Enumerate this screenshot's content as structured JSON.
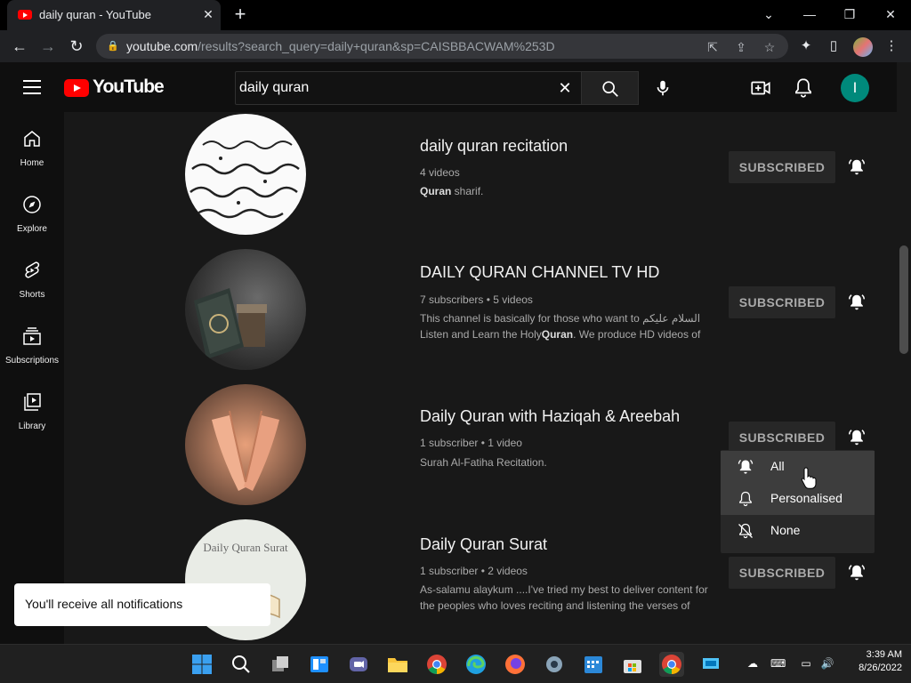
{
  "browser": {
    "tab_title": "daily quran - YouTube",
    "url_domain": "youtube.com",
    "url_path": "/results?search_query=daily+quran&sp=CAISBBACWAM%253D"
  },
  "header": {
    "logo_text": "YouTube",
    "search_value": "daily quran",
    "avatar_letter": "I"
  },
  "sidebar": {
    "items": [
      {
        "label": "Home",
        "icon": "home-icon"
      },
      {
        "label": "Explore",
        "icon": "compass-icon"
      },
      {
        "label": "Shorts",
        "icon": "shorts-icon"
      },
      {
        "label": "Subscriptions",
        "icon": "subscriptions-icon"
      },
      {
        "label": "Library",
        "icon": "library-icon"
      }
    ]
  },
  "results": [
    {
      "title": "daily quran recitation",
      "meta": "4 videos",
      "desc_bold": "Quran",
      "desc_rest": " sharif.",
      "button": "SUBSCRIBED"
    },
    {
      "title": "DAILY QURAN CHANNEL TV HD",
      "meta": "7 subscribers • 5 videos",
      "desc_line1": "This channel is basically for those who want to السلام عليكم",
      "desc_line2a": " Listen and Learn the Holy",
      "desc_bold": "Quran",
      "desc_line2b": ". We produce HD videos of",
      "button": "SUBSCRIBED"
    },
    {
      "title": "Daily Quran with Haziqah & Areebah",
      "meta": "1 subscriber • 1 video",
      "desc": "Surah Al-Fatiha Recitation.",
      "button": "SUBSCRIBED"
    },
    {
      "title": "Daily Quran Surat",
      "meta": "1 subscriber • 2 videos",
      "desc_line1": "As-salamu alaykum ....I've tried my best to deliver content for",
      "desc_line2": "the peoples who loves reciting and listening the verses of",
      "thumb_text": "Daily Quran Surat",
      "button": "SUBSCRIBED"
    }
  ],
  "notification_menu": {
    "options": [
      "All",
      "Personalised",
      "None"
    ]
  },
  "toast": "You'll receive all notifications",
  "taskbar": {
    "time": "3:39 AM",
    "date": "8/26/2022"
  },
  "colors": {
    "youtube_red": "#ff0000",
    "avatar_bg": "#00897b",
    "background": "#0f0f0f",
    "results_bg": "#181818"
  }
}
